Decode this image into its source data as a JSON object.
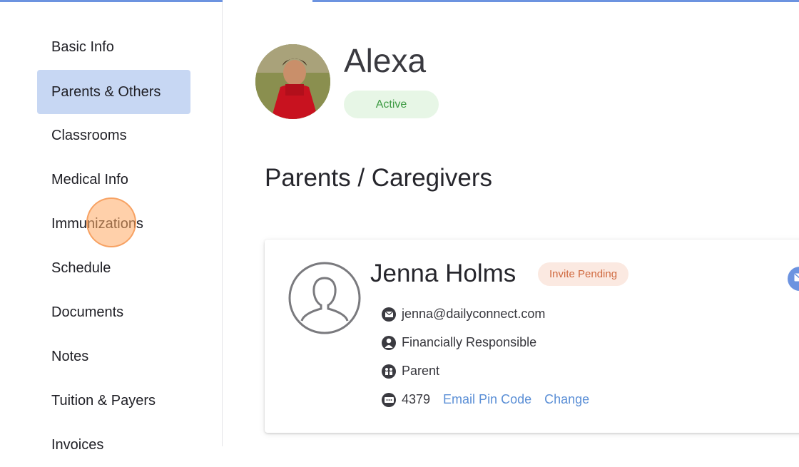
{
  "sidebar": {
    "items": [
      {
        "label": "Basic Info",
        "active": false
      },
      {
        "label": "Parents & Others",
        "active": true
      },
      {
        "label": "Classrooms",
        "active": false
      },
      {
        "label": "Medical Info",
        "active": false
      },
      {
        "label": "Immunizations",
        "active": false
      },
      {
        "label": "Schedule",
        "active": false
      },
      {
        "label": "Documents",
        "active": false
      },
      {
        "label": "Notes",
        "active": false
      },
      {
        "label": "Tuition & Payers",
        "active": false
      },
      {
        "label": "Invoices",
        "active": false
      }
    ]
  },
  "child": {
    "name": "Alexa",
    "status": "Active"
  },
  "section": {
    "title": "Parents / Caregivers"
  },
  "contact": {
    "name": "Jenna Holms",
    "badge": "Invite Pending",
    "email": "jenna@dailyconnect.com",
    "financial": "Financially Responsible",
    "relation": "Parent",
    "pin": "4379",
    "email_pin_link": "Email Pin Code",
    "change_link": "Change"
  },
  "colors": {
    "accent": "#6c93e0",
    "active_nav": "#c7d7f3",
    "status_green": "#3e9b44",
    "invite_orange": "#d0693f",
    "link_blue": "#5b8fd6"
  },
  "icons": {
    "email": "envelope-icon",
    "financial": "dollar-person-icon",
    "relation": "family-icon",
    "pin": "keypad-icon",
    "avatar_placeholder": "person-outline-icon"
  }
}
